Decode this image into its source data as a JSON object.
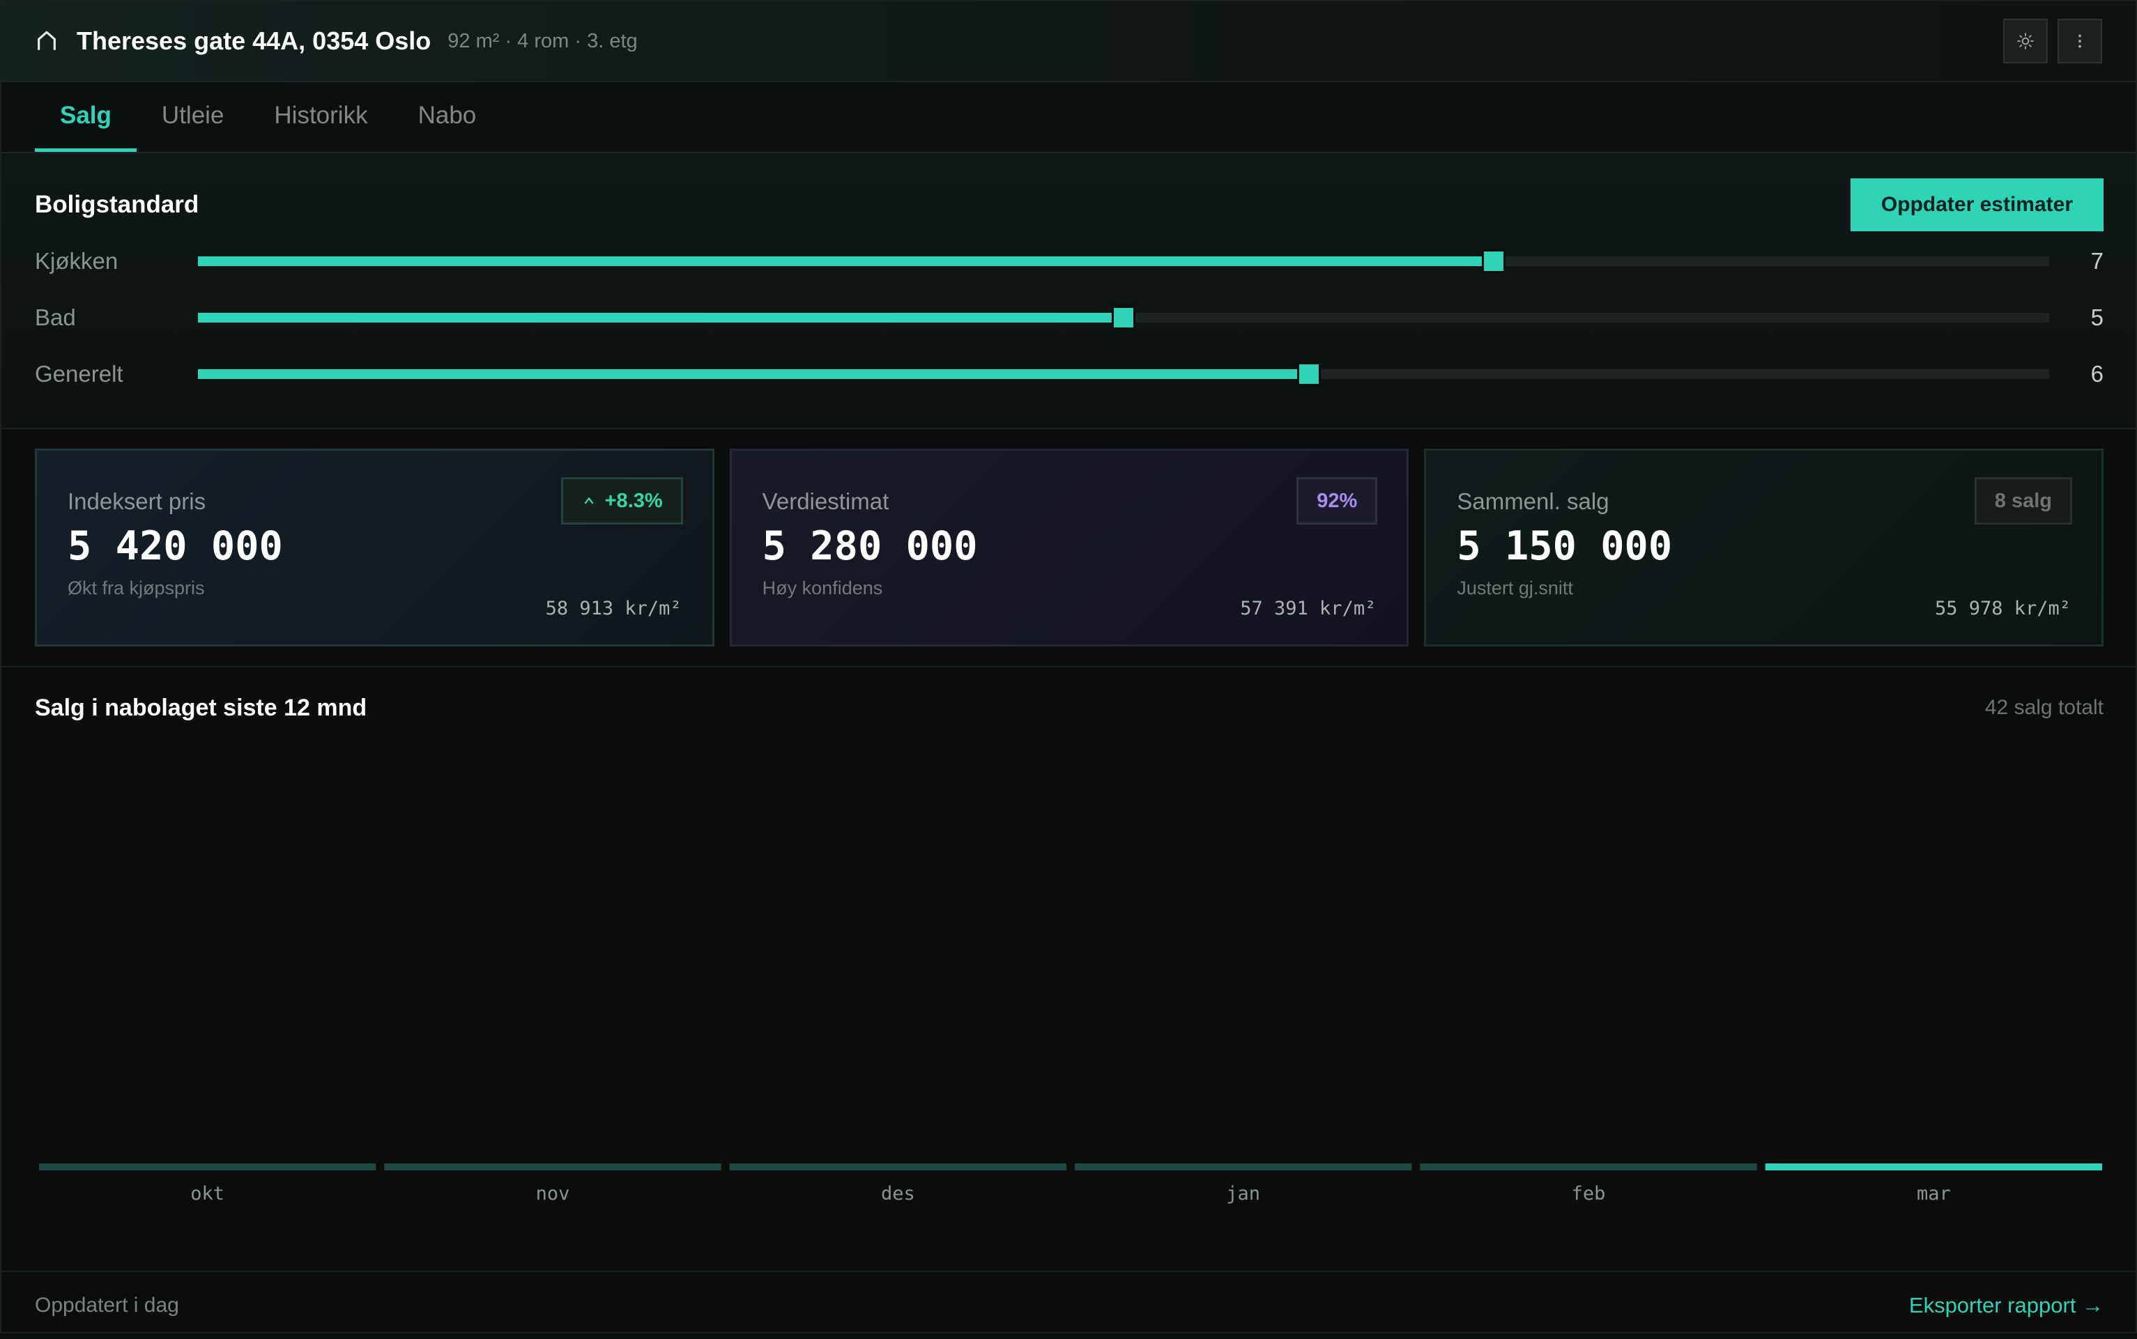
{
  "header": {
    "address": "Thereses gate 44A, 0354 Oslo",
    "meta": "92 m² · 4 rom · 3. etg"
  },
  "tabs": [
    {
      "label": "Salg",
      "active": true
    },
    {
      "label": "Utleie",
      "active": false
    },
    {
      "label": "Historikk",
      "active": false
    },
    {
      "label": "Nabo",
      "active": false
    }
  ],
  "standard": {
    "title": "Boligstandard",
    "update_button": "Oppdater estimater",
    "sliders": [
      {
        "label": "Kjøkken",
        "value": "7",
        "level": 0.7
      },
      {
        "label": "Bad",
        "value": "5",
        "level": 0.5
      },
      {
        "label": "Generelt",
        "value": "6",
        "level": 0.6
      }
    ]
  },
  "cards": [
    {
      "label": "Indeksert pris",
      "value": "5 420 000",
      "sub": "Økt fra kjøpspris",
      "unit": "58 913 kr/m²",
      "badge": "+8.3%"
    },
    {
      "label": "Verdiestimat",
      "value": "5 280 000",
      "sub": "Høy konfidens",
      "unit": "57 391 kr/m²",
      "badge": "92%"
    },
    {
      "label": "Sammenl. salg",
      "value": "5 150 000",
      "sub": "Justert gj.snitt",
      "unit": "55 978 kr/m²",
      "badge": "8 salg"
    }
  ],
  "chart": {
    "title": "Salg i nabolaget siste 12 mnd",
    "total": "42 salg totalt"
  },
  "chart_data": {
    "type": "bar",
    "categories": [
      "okt",
      "nov",
      "des",
      "jan",
      "feb",
      "mar"
    ],
    "highlighted": "mar",
    "colors": {
      "bar": "#1f4a43",
      "highlight": "#2ed3b8"
    }
  },
  "footer": {
    "updated": "Oppdatert i dag",
    "export_link": "Eksporter rapport →"
  },
  "colors": {
    "accent": "#2ed3b8",
    "background": "#0b0d0d"
  }
}
